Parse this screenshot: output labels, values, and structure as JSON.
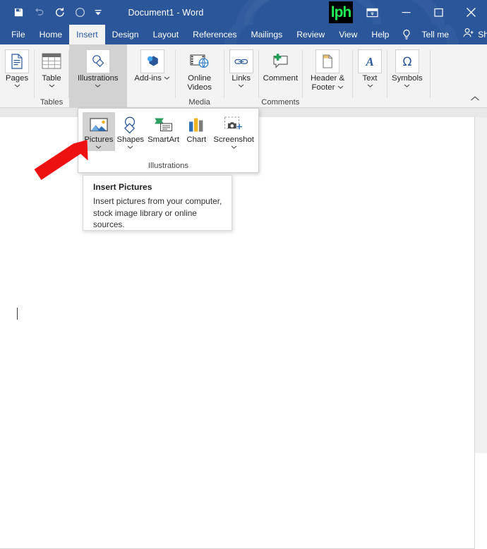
{
  "window": {
    "title": "Document1  -  Word",
    "logo_text": "lph",
    "quick_access": [
      {
        "name": "save-icon",
        "label": "Save"
      },
      {
        "name": "undo-icon",
        "label": "Undo"
      },
      {
        "name": "redo-icon",
        "label": "Redo"
      },
      {
        "name": "touch-mode-icon",
        "label": "Touch/Mouse Mode"
      },
      {
        "name": "customize-qat-icon",
        "label": "Customize Quick Access Toolbar"
      }
    ],
    "controls": [
      {
        "name": "ribbon-display-options-icon",
        "label": "Ribbon Display Options"
      },
      {
        "name": "minimize-icon",
        "label": "Minimize"
      },
      {
        "name": "maximize-icon",
        "label": "Maximize"
      },
      {
        "name": "close-icon",
        "label": "Close"
      }
    ]
  },
  "tabs": [
    {
      "label": "File",
      "active": false
    },
    {
      "label": "Home",
      "active": false
    },
    {
      "label": "Insert",
      "active": true
    },
    {
      "label": "Design",
      "active": false
    },
    {
      "label": "Layout",
      "active": false
    },
    {
      "label": "References",
      "active": false
    },
    {
      "label": "Mailings",
      "active": false
    },
    {
      "label": "Review",
      "active": false
    },
    {
      "label": "View",
      "active": false
    },
    {
      "label": "Help",
      "active": false
    }
  ],
  "tellme": {
    "label": "Tell me",
    "icon": "lightbulb-icon"
  },
  "share": {
    "label": "Share",
    "icon": "share-person-icon"
  },
  "ribbon": {
    "groups": [
      {
        "name": "pages",
        "button": "Pages",
        "icon": "pages-icon",
        "group_label": "",
        "selected": false,
        "caret": true
      },
      {
        "name": "table",
        "button": "Table",
        "icon": "table-icon",
        "group_label": "Tables",
        "selected": false,
        "caret": true
      },
      {
        "name": "illustrations",
        "button": "Illustrations",
        "icon": "illustrations-icon",
        "group_label": "",
        "selected": true,
        "caret": true
      },
      {
        "name": "add-ins",
        "button": "Add-ins",
        "icon": "addins-icon",
        "group_label": "",
        "selected": false,
        "caret": true
      },
      {
        "name": "online-videos",
        "button": "Online Videos",
        "icon": "online-video-icon",
        "group_label": "Media",
        "selected": false,
        "caret": false
      },
      {
        "name": "links",
        "button": "Links",
        "icon": "links-icon",
        "group_label": "",
        "selected": false,
        "caret": true
      },
      {
        "name": "comment",
        "button": "Comment",
        "icon": "new-comment-icon",
        "group_label": "Comments",
        "selected": false,
        "caret": false
      },
      {
        "name": "header-footer",
        "button": "Header & Footer",
        "icon": "header-footer-icon",
        "group_label": "",
        "selected": false,
        "caret": true
      },
      {
        "name": "text",
        "button": "Text",
        "icon": "text-icon",
        "group_label": "",
        "selected": false,
        "caret": true
      },
      {
        "name": "symbols",
        "button": "Symbols",
        "icon": "omega-icon",
        "group_label": "",
        "selected": false,
        "caret": true
      }
    ],
    "collapse_icon": "collapse-ribbon-icon"
  },
  "dropdown": {
    "group_label": "Illustrations",
    "items": [
      {
        "label": "Pictures",
        "icon": "pictures-icon",
        "selected": true,
        "caret": true
      },
      {
        "label": "Shapes",
        "icon": "shapes-icon",
        "selected": false,
        "caret": true
      },
      {
        "label": "SmartArt",
        "icon": "smartart-icon",
        "selected": false,
        "caret": false
      },
      {
        "label": "Chart",
        "icon": "chart-icon",
        "selected": false,
        "caret": false
      },
      {
        "label": "Screenshot",
        "icon": "screenshot-icon",
        "selected": false,
        "caret": true
      }
    ]
  },
  "tooltip": {
    "title": "Insert Pictures",
    "body": "Insert pictures from your computer, stock image library or online sources."
  },
  "annotation": {
    "name": "red-arrow",
    "color": "#ee1111",
    "points_to": "Pictures"
  },
  "colors": {
    "titlebar": "#2b579a",
    "ribbon_bg": "#f3f3f3",
    "selected_group": "#d2d2d2",
    "accent_blue": "#2b579a",
    "annotation_red": "#ee1111",
    "logo_green": "#22ee55"
  }
}
